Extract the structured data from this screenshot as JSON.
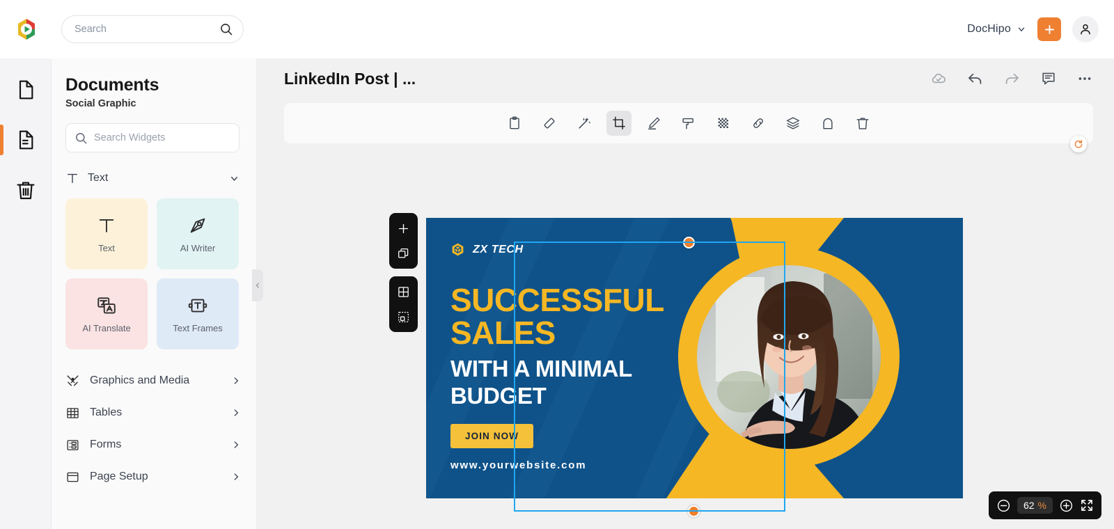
{
  "header": {
    "logo": "dochipo-logo-icon",
    "search": {
      "placeholder": "Search",
      "value": "",
      "icon": "search-icon"
    },
    "brand": {
      "label": "DocHipo",
      "chevron": "chevron-down-icon"
    },
    "add_button": {
      "icon": "plus-icon",
      "color": "#ef7f31"
    },
    "account_button": {
      "icon": "user-icon"
    }
  },
  "rail": {
    "items": [
      {
        "name": "pages",
        "icon": "page-icon",
        "active": false
      },
      {
        "name": "widgets",
        "icon": "document-lines-icon",
        "active": true
      },
      {
        "name": "trash",
        "icon": "trash-icon",
        "active": false
      }
    ]
  },
  "panel": {
    "title": "Documents",
    "subtitle": "Social Graphic",
    "search": {
      "placeholder": "Search Widgets",
      "value": "",
      "icon": "search-icon"
    },
    "section": {
      "label": "Text",
      "icon": "text-t-icon",
      "chevron": "chevron-down-icon"
    },
    "cards": [
      {
        "label": "Text",
        "icon": "text-t-icon",
        "bg": "#fdf2d9"
      },
      {
        "label": "AI Writer",
        "icon": "pen-nib-icon",
        "bg": "#e1f3f3"
      },
      {
        "label": "AI Translate",
        "icon": "translate-icon",
        "bg": "#fbe3e3"
      },
      {
        "label": "Text Frames",
        "icon": "text-frame-icon",
        "bg": "#dfeaf7"
      }
    ],
    "menu": [
      {
        "label": "Graphics and Media",
        "icon": "graphics-media-icon",
        "chevron": "chevron-right-icon"
      },
      {
        "label": "Tables",
        "icon": "table-grid-icon",
        "chevron": "chevron-right-icon"
      },
      {
        "label": "Forms",
        "icon": "forms-icon",
        "chevron": "chevron-right-icon"
      },
      {
        "label": "Page Setup",
        "icon": "page-setup-icon",
        "chevron": "chevron-right-icon"
      }
    ],
    "collapse": {
      "icon": "chevron-left-icon"
    }
  },
  "document": {
    "title": "LinkedIn Post | ...",
    "actions": [
      {
        "name": "cloud-saved",
        "icon": "cloud-check-icon"
      },
      {
        "name": "undo",
        "icon": "undo-arrow-icon"
      },
      {
        "name": "redo",
        "icon": "redo-arrow-icon"
      },
      {
        "name": "comments",
        "icon": "comment-icon"
      },
      {
        "name": "more-options",
        "icon": "ellipsis-icon"
      }
    ]
  },
  "edit_toolbar": {
    "items": [
      {
        "name": "clipboard",
        "icon": "clipboard-icon",
        "active": false
      },
      {
        "name": "eraser",
        "icon": "eraser-icon",
        "active": false
      },
      {
        "name": "magic-wand",
        "icon": "magic-wand-icon",
        "active": false
      },
      {
        "name": "crop",
        "icon": "crop-icon",
        "active": true
      },
      {
        "name": "pencil-edit",
        "icon": "pencil-icon",
        "active": false
      },
      {
        "name": "paint-roller",
        "icon": "paint-roller-icon",
        "active": false
      },
      {
        "name": "transparency",
        "icon": "checkerboard-icon",
        "active": false
      },
      {
        "name": "link",
        "icon": "link-icon",
        "active": false
      },
      {
        "name": "layers",
        "icon": "layers-icon",
        "active": false
      },
      {
        "name": "lock",
        "icon": "lock-icon",
        "active": false
      },
      {
        "name": "delete",
        "icon": "trash-icon",
        "active": false
      }
    ]
  },
  "page_tools": {
    "group1": [
      {
        "name": "add-page",
        "icon": "plus-icon"
      },
      {
        "name": "duplicate-page",
        "icon": "duplicate-icon"
      }
    ],
    "group2": [
      {
        "name": "grid-view",
        "icon": "grid-icon"
      },
      {
        "name": "select-area",
        "icon": "dashed-select-icon"
      }
    ]
  },
  "design": {
    "background_color": "#0f5289",
    "accent_color": "#f5b724",
    "brand": {
      "name": "ZX TECH",
      "icon": "hexagon-cube-icon"
    },
    "headline": "SUCCESSFUL SALES",
    "headline_line1": "SUCCESSFUL",
    "headline_line2": "SALES",
    "subhead_line1": "WITH A MINIMAL",
    "subhead_line2": "BUDGET",
    "cta_label": "JOIN NOW",
    "website": "www.yourwebsite.com",
    "photo": "smiling-businesswoman-photo"
  },
  "selection": {
    "handles": [
      {
        "name": "top-left-handle",
        "color": "#f07f2a"
      },
      {
        "name": "top-right-handle",
        "color": "#1c9ae8"
      },
      {
        "name": "bottom-left-handle",
        "color": "#f07f2a"
      },
      {
        "name": "bottom-right-handle",
        "color": "#f07f2a"
      }
    ],
    "rotate_handle": {
      "name": "rotate-handle",
      "icon": "rotate-icon"
    },
    "border_color": "#1fa7f0",
    "cursor_annotation": {
      "name": "pointer-arrow",
      "color": "#e8295b"
    }
  },
  "zoom_control": {
    "minus": "minus-circle-icon",
    "value": "62",
    "unit": "%",
    "plus": "plus-circle-icon",
    "fullscreen": "fullscreen-icon"
  }
}
